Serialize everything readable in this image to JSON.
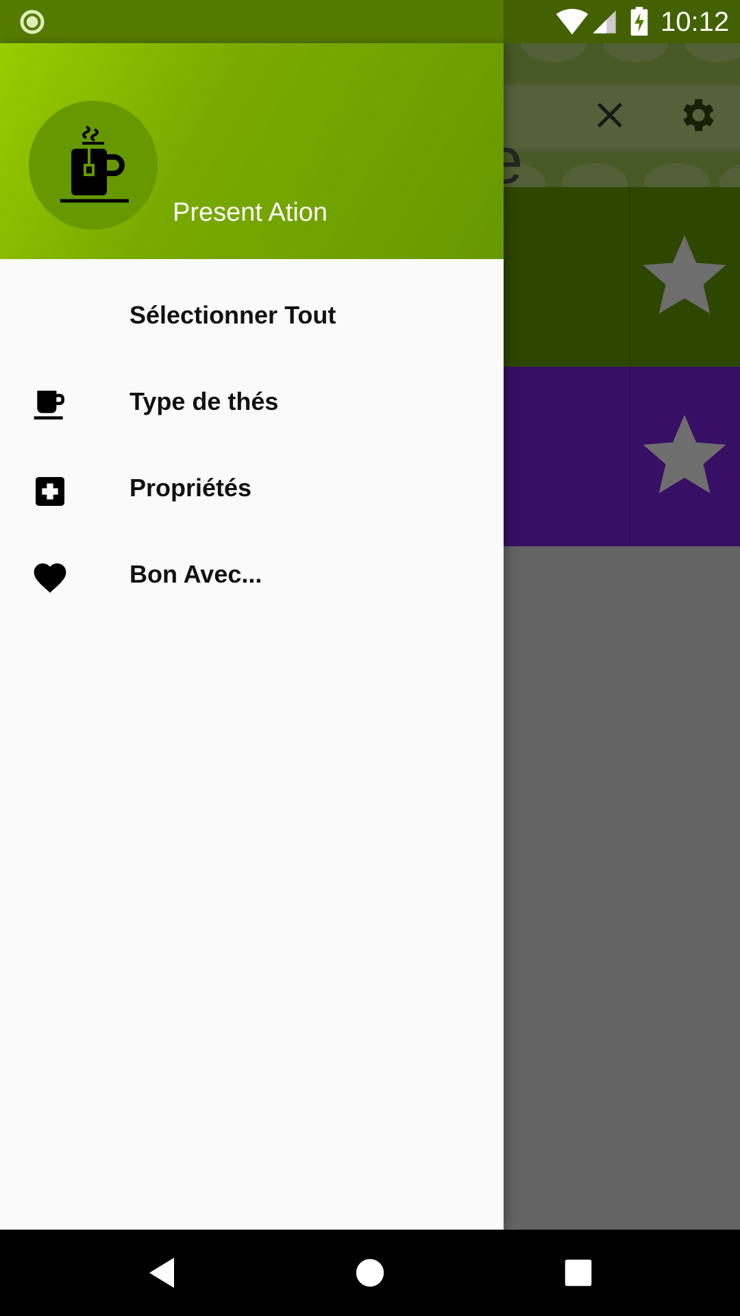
{
  "status_bar": {
    "time": "10:12"
  },
  "drawer": {
    "header": {
      "profile_name": "Present Ation"
    },
    "menu": [
      {
        "label": "Sélectionner Tout",
        "icon": "none"
      },
      {
        "label": "Type de thés",
        "icon": "coffee-cup-icon"
      },
      {
        "label": "Propriétés",
        "icon": "medical-plus-icon"
      },
      {
        "label": "Bon Avec...",
        "icon": "heart-icon"
      }
    ]
  },
  "background_app": {
    "search_text": "e"
  },
  "colors": {
    "header_start": "#99cc00",
    "header_end": "#669900",
    "row1": "#5b8c00",
    "row2": "#6f1ec8"
  }
}
